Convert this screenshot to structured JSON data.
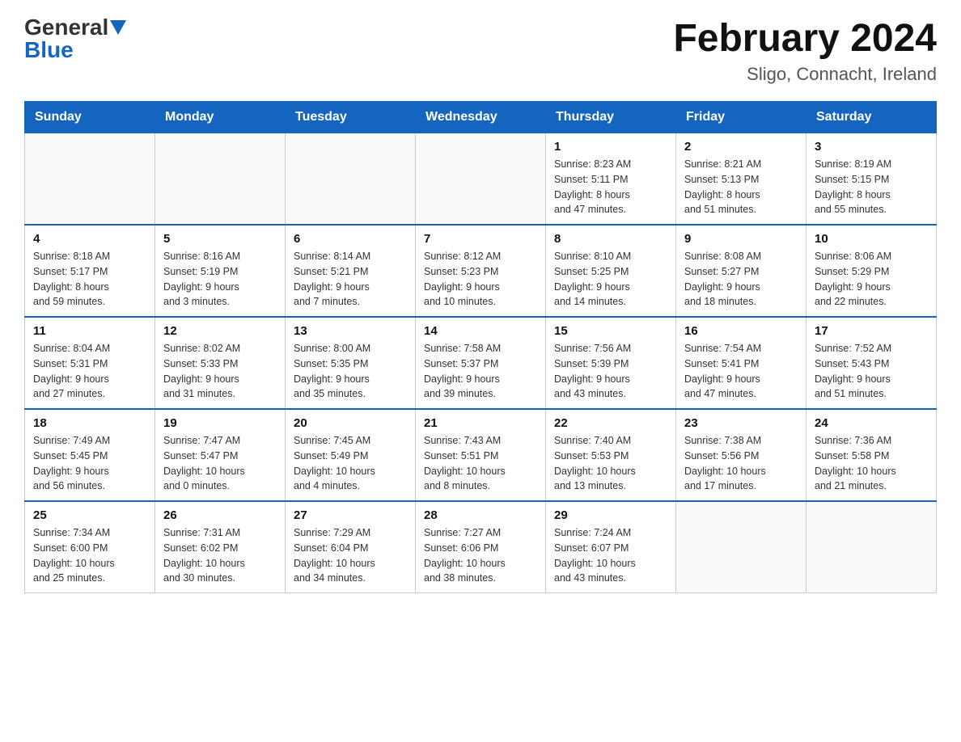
{
  "header": {
    "logo_general": "General",
    "logo_blue": "Blue",
    "month_title": "February 2024",
    "location": "Sligo, Connacht, Ireland"
  },
  "weekdays": [
    "Sunday",
    "Monday",
    "Tuesday",
    "Wednesday",
    "Thursday",
    "Friday",
    "Saturday"
  ],
  "weeks": [
    [
      {
        "day": "",
        "info": ""
      },
      {
        "day": "",
        "info": ""
      },
      {
        "day": "",
        "info": ""
      },
      {
        "day": "",
        "info": ""
      },
      {
        "day": "1",
        "info": "Sunrise: 8:23 AM\nSunset: 5:11 PM\nDaylight: 8 hours\nand 47 minutes."
      },
      {
        "day": "2",
        "info": "Sunrise: 8:21 AM\nSunset: 5:13 PM\nDaylight: 8 hours\nand 51 minutes."
      },
      {
        "day": "3",
        "info": "Sunrise: 8:19 AM\nSunset: 5:15 PM\nDaylight: 8 hours\nand 55 minutes."
      }
    ],
    [
      {
        "day": "4",
        "info": "Sunrise: 8:18 AM\nSunset: 5:17 PM\nDaylight: 8 hours\nand 59 minutes."
      },
      {
        "day": "5",
        "info": "Sunrise: 8:16 AM\nSunset: 5:19 PM\nDaylight: 9 hours\nand 3 minutes."
      },
      {
        "day": "6",
        "info": "Sunrise: 8:14 AM\nSunset: 5:21 PM\nDaylight: 9 hours\nand 7 minutes."
      },
      {
        "day": "7",
        "info": "Sunrise: 8:12 AM\nSunset: 5:23 PM\nDaylight: 9 hours\nand 10 minutes."
      },
      {
        "day": "8",
        "info": "Sunrise: 8:10 AM\nSunset: 5:25 PM\nDaylight: 9 hours\nand 14 minutes."
      },
      {
        "day": "9",
        "info": "Sunrise: 8:08 AM\nSunset: 5:27 PM\nDaylight: 9 hours\nand 18 minutes."
      },
      {
        "day": "10",
        "info": "Sunrise: 8:06 AM\nSunset: 5:29 PM\nDaylight: 9 hours\nand 22 minutes."
      }
    ],
    [
      {
        "day": "11",
        "info": "Sunrise: 8:04 AM\nSunset: 5:31 PM\nDaylight: 9 hours\nand 27 minutes."
      },
      {
        "day": "12",
        "info": "Sunrise: 8:02 AM\nSunset: 5:33 PM\nDaylight: 9 hours\nand 31 minutes."
      },
      {
        "day": "13",
        "info": "Sunrise: 8:00 AM\nSunset: 5:35 PM\nDaylight: 9 hours\nand 35 minutes."
      },
      {
        "day": "14",
        "info": "Sunrise: 7:58 AM\nSunset: 5:37 PM\nDaylight: 9 hours\nand 39 minutes."
      },
      {
        "day": "15",
        "info": "Sunrise: 7:56 AM\nSunset: 5:39 PM\nDaylight: 9 hours\nand 43 minutes."
      },
      {
        "day": "16",
        "info": "Sunrise: 7:54 AM\nSunset: 5:41 PM\nDaylight: 9 hours\nand 47 minutes."
      },
      {
        "day": "17",
        "info": "Sunrise: 7:52 AM\nSunset: 5:43 PM\nDaylight: 9 hours\nand 51 minutes."
      }
    ],
    [
      {
        "day": "18",
        "info": "Sunrise: 7:49 AM\nSunset: 5:45 PM\nDaylight: 9 hours\nand 56 minutes."
      },
      {
        "day": "19",
        "info": "Sunrise: 7:47 AM\nSunset: 5:47 PM\nDaylight: 10 hours\nand 0 minutes."
      },
      {
        "day": "20",
        "info": "Sunrise: 7:45 AM\nSunset: 5:49 PM\nDaylight: 10 hours\nand 4 minutes."
      },
      {
        "day": "21",
        "info": "Sunrise: 7:43 AM\nSunset: 5:51 PM\nDaylight: 10 hours\nand 8 minutes."
      },
      {
        "day": "22",
        "info": "Sunrise: 7:40 AM\nSunset: 5:53 PM\nDaylight: 10 hours\nand 13 minutes."
      },
      {
        "day": "23",
        "info": "Sunrise: 7:38 AM\nSunset: 5:56 PM\nDaylight: 10 hours\nand 17 minutes."
      },
      {
        "day": "24",
        "info": "Sunrise: 7:36 AM\nSunset: 5:58 PM\nDaylight: 10 hours\nand 21 minutes."
      }
    ],
    [
      {
        "day": "25",
        "info": "Sunrise: 7:34 AM\nSunset: 6:00 PM\nDaylight: 10 hours\nand 25 minutes."
      },
      {
        "day": "26",
        "info": "Sunrise: 7:31 AM\nSunset: 6:02 PM\nDaylight: 10 hours\nand 30 minutes."
      },
      {
        "day": "27",
        "info": "Sunrise: 7:29 AM\nSunset: 6:04 PM\nDaylight: 10 hours\nand 34 minutes."
      },
      {
        "day": "28",
        "info": "Sunrise: 7:27 AM\nSunset: 6:06 PM\nDaylight: 10 hours\nand 38 minutes."
      },
      {
        "day": "29",
        "info": "Sunrise: 7:24 AM\nSunset: 6:07 PM\nDaylight: 10 hours\nand 43 minutes."
      },
      {
        "day": "",
        "info": ""
      },
      {
        "day": "",
        "info": ""
      }
    ]
  ]
}
